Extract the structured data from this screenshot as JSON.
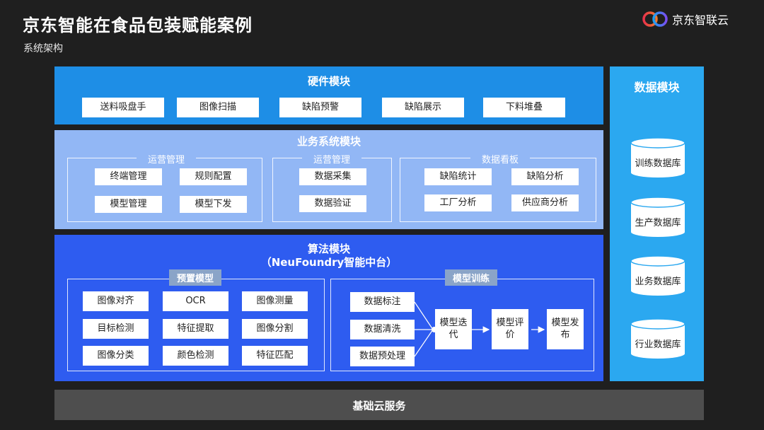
{
  "header": {
    "title": "京东智能在食品包装赋能案例",
    "subtitle": "系统架构",
    "logo_text": "京东智联云",
    "logo_icon": "jd-cloud-logo-icon"
  },
  "hardware": {
    "title": "硬件模块",
    "items": [
      "送料吸盘手",
      "图像扫描",
      "缺陷预警",
      "缺陷展示",
      "下料堆叠"
    ]
  },
  "business": {
    "title": "业务系统模块",
    "groups": [
      {
        "label": "运营管理",
        "items": [
          "终端管理",
          "规则配置",
          "模型管理",
          "模型下发"
        ]
      },
      {
        "label": "运营管理",
        "items": [
          "数据采集",
          "数据验证"
        ]
      },
      {
        "label": "数据看板",
        "items": [
          "缺陷统计",
          "缺陷分析",
          "工厂分析",
          "供应商分析"
        ]
      }
    ]
  },
  "algorithm": {
    "title": "算法模块",
    "subtitle": "（NeuFoundry智能中台）",
    "preset": {
      "label": "预置模型",
      "items": [
        "图像对齐",
        "OCR",
        "图像测量",
        "目标检测",
        "特征提取",
        "图像分割",
        "图像分类",
        "颜色检测",
        "特征匹配"
      ]
    },
    "training": {
      "label": "模型训练",
      "inputs": [
        "数据标注",
        "数据清洗",
        "数据预处理"
      ],
      "steps": [
        "模型迭代",
        "模型评价",
        "模型发布"
      ]
    }
  },
  "data_module": {
    "title": "数据模块",
    "stores": [
      "训练数据库",
      "生产数据库",
      "业务数据库",
      "行业数据库"
    ]
  },
  "base": {
    "title": "基础云服务"
  },
  "colors": {
    "hardware": "#1e8ee6",
    "business": "#92b7f5",
    "algorithm": "#2e5cf0",
    "data": "#2ba8f0",
    "base": "#4e4e4e",
    "background": "#1f1f1f"
  }
}
